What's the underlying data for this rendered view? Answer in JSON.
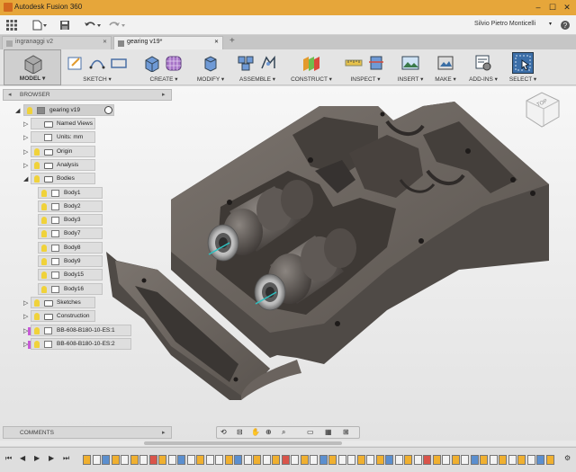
{
  "app": {
    "title": "Autodesk Fusion 360",
    "user": "Silvio Pietro Monticelli",
    "window_controls": [
      "–",
      "☐",
      "✕"
    ]
  },
  "tabs": [
    {
      "label": "ingranaggi v2",
      "close": "✕"
    },
    {
      "label": "gearing v19*",
      "close": "✕"
    }
  ],
  "tab_add": "+",
  "ribbon": {
    "workspace_label": "MODEL ▾",
    "groups": [
      {
        "label": "SKETCH ▾"
      },
      {
        "label": "CREATE ▾"
      },
      {
        "label": "MODIFY ▾"
      },
      {
        "label": "ASSEMBLE ▾"
      },
      {
        "label": "CONSTRUCT ▾"
      },
      {
        "label": "INSPECT ▾"
      },
      {
        "label": "INSERT ▾"
      },
      {
        "label": "MAKE ▾"
      },
      {
        "label": "ADD-INS ▾"
      },
      {
        "label": "SELECT ▾"
      }
    ]
  },
  "browser": {
    "header": "BROWSER",
    "root": "gearing v19",
    "items": [
      {
        "label": "Named Views",
        "level": 1,
        "bulb": false
      },
      {
        "label": "Units: mm",
        "level": 1,
        "bulb": false,
        "doc": true
      },
      {
        "label": "Origin",
        "level": 1,
        "bulb": true
      },
      {
        "label": "Analysis",
        "level": 1,
        "bulb": true
      },
      {
        "label": "Bodies",
        "level": 1,
        "bulb": true,
        "expanded": true
      },
      {
        "label": "Body1",
        "level": 2
      },
      {
        "label": "Body2",
        "level": 2
      },
      {
        "label": "Body3",
        "level": 2
      },
      {
        "label": "Body7",
        "level": 2
      },
      {
        "label": "Body8",
        "level": 2
      },
      {
        "label": "Body9",
        "level": 2
      },
      {
        "label": "Body15",
        "level": 2
      },
      {
        "label": "Body16",
        "level": 2
      },
      {
        "label": "Sketches",
        "level": 1,
        "bulb": true
      },
      {
        "label": "Construction",
        "level": 1,
        "bulb": true
      },
      {
        "label": "BB-608-B180-10-ES:1",
        "level": 1,
        "bulb": true,
        "component": true
      },
      {
        "label": "BB-608-B180-10-ES:2",
        "level": 1,
        "bulb": true,
        "component": true
      }
    ]
  },
  "comments": "COMMENTS",
  "viewcube_face": "TOP",
  "colors": {
    "titlebar": "#e6a63a",
    "part": "#5e5854",
    "part_light": "#7a736d",
    "accent": "#0696d7"
  }
}
